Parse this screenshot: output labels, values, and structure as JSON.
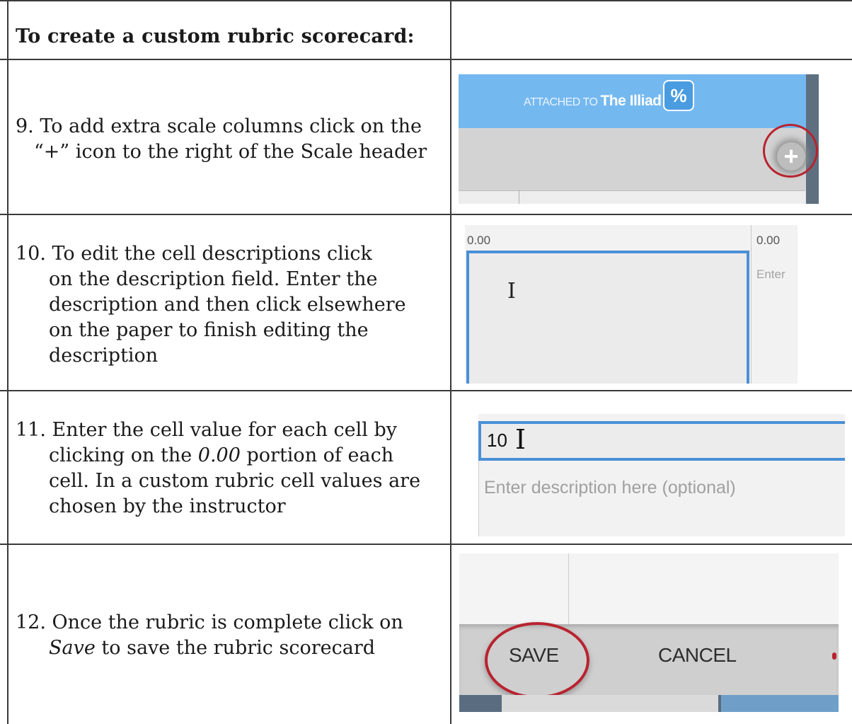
{
  "header": {
    "title": "To create a custom rubric scorecard:"
  },
  "steps": [
    {
      "line1": "9. To add extra scale columns click on the",
      "line2": "“+” icon to the right of the Scale header"
    },
    {
      "line1": "10.  To edit the cell descriptions click",
      "line2": "on the description field. Enter the",
      "line3": "description and then click elsewhere",
      "line4": "on the paper to finish editing the",
      "line5": "description"
    },
    {
      "line1": "11. Enter the cell value for each cell by",
      "line2a": "clicking on the ",
      "line2_em": "0.00",
      "line2b": " portion of each",
      "line3": "cell. In a custom rubric cell values are",
      "line4": "chosen by the instructor"
    },
    {
      "line1": "12. Once the rubric is complete click on",
      "line2_em": "Save",
      "line2b": " to save the rubric scorecard"
    }
  ],
  "screenshots": {
    "shot1": {
      "attached_to": "ATTACHED TO",
      "assignment": "The Illiad",
      "pct_icon": "%",
      "plus_icon": "+"
    },
    "shot2": {
      "value_left": "0.00",
      "value_right": "0.00",
      "enter_text": "Enter",
      "cursor": "I"
    },
    "shot3": {
      "value": "10",
      "cursor": "I",
      "placeholder": "Enter description here (optional)"
    },
    "shot4": {
      "save": "SAVE",
      "cancel": "CANCEL"
    }
  },
  "colors": {
    "highlight_ring": "#b8232f",
    "header_blue": "#74b8f0",
    "focus_blue": "#4a90d6"
  }
}
